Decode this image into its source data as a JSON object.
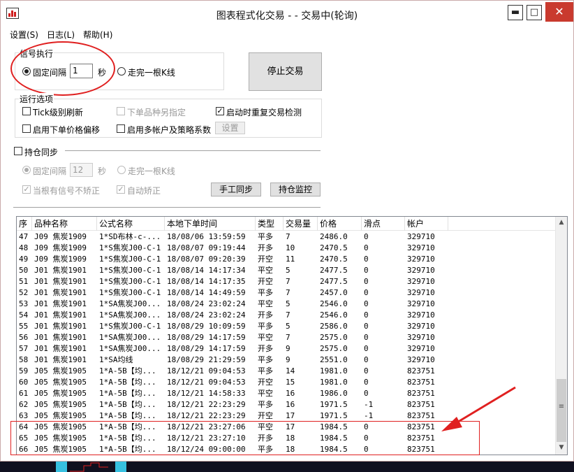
{
  "window": {
    "title": "图表程式化交易 - - 交易中(轮询)",
    "minimize": "▬",
    "maximize": "□",
    "close": "✕"
  },
  "menu": [
    "设置(S)",
    "日志(L)",
    "帮助(H)"
  ],
  "signal": {
    "group_label": "信号执行",
    "fixed_interval_label": "固定间隔",
    "interval_value": "1",
    "seconds_unit": "秒",
    "bar_complete_label": "走完一根K线",
    "stop_button": "停止交易"
  },
  "run_options": {
    "group_label": "运行选项",
    "tick_refresh": "Tick级别刷新",
    "order_variety": "下单品种另指定",
    "startup_check": "启动时重复交易检测",
    "price_offset": "启用下单价格偏移",
    "multi_account": "启用多帐户及策略系数",
    "settings_button": "设置"
  },
  "position_sync": {
    "label": "持仓同步",
    "fixed_interval_label": "固定间隔",
    "interval_value": "12",
    "seconds_unit": "秒",
    "bar_complete_label": "走完一根K线",
    "no_correct_label": "当根有信号不矫正",
    "auto_correct_label": "自动矫正",
    "manual_sync_button": "手工同步",
    "monitor_button": "持仓监控"
  },
  "table": {
    "columns": [
      "序",
      "品种名称",
      "公式名称",
      "本地下单时间",
      "类型",
      "交易量",
      "价格",
      "滑点",
      "帐户"
    ],
    "rows": [
      [
        "47",
        "J09 焦炭1909",
        "1*SD布林-c-...",
        "18/08/06 13:59:59",
        "平多",
        "7",
        "2486.0",
        "0",
        "329710"
      ],
      [
        "48",
        "J09 焦炭1909",
        "1*S焦炭J00-C-1",
        "18/08/07 09:19:44",
        "开多",
        "10",
        "2470.5",
        "0",
        "329710"
      ],
      [
        "49",
        "J09 焦炭1909",
        "1*S焦炭J00-C-1",
        "18/08/07 09:20:39",
        "开空",
        "11",
        "2470.5",
        "0",
        "329710"
      ],
      [
        "50",
        "J01 焦炭1901",
        "1*S焦炭J00-C-1",
        "18/08/14 14:17:34",
        "平空",
        "5",
        "2477.5",
        "0",
        "329710"
      ],
      [
        "51",
        "J01 焦炭1901",
        "1*S焦炭J00-C-1",
        "18/08/14 14:17:35",
        "开空",
        "7",
        "2477.5",
        "0",
        "329710"
      ],
      [
        "52",
        "J01 焦炭1901",
        "1*S焦炭J00-C-1",
        "18/08/14 14:49:59",
        "平多",
        "7",
        "2457.0",
        "0",
        "329710"
      ],
      [
        "53",
        "J01 焦炭1901",
        "1*SA焦炭J00...",
        "18/08/24 23:02:24",
        "平空",
        "5",
        "2546.0",
        "0",
        "329710"
      ],
      [
        "54",
        "J01 焦炭1901",
        "1*SA焦炭J00...",
        "18/08/24 23:02:24",
        "开多",
        "7",
        "2546.0",
        "0",
        "329710"
      ],
      [
        "55",
        "J01 焦炭1901",
        "1*S焦炭J00-C-1",
        "18/08/29 10:09:59",
        "平多",
        "5",
        "2586.0",
        "0",
        "329710"
      ],
      [
        "56",
        "J01 焦炭1901",
        "1*SA焦炭J00...",
        "18/08/29 14:17:59",
        "平空",
        "7",
        "2575.0",
        "0",
        "329710"
      ],
      [
        "57",
        "J01 焦炭1901",
        "1*SA焦炭J00...",
        "18/08/29 14:17:59",
        "开多",
        "9",
        "2575.0",
        "0",
        "329710"
      ],
      [
        "58",
        "J01 焦炭1901",
        "1*SA均线",
        "18/08/29 21:29:59",
        "平多",
        "9",
        "2551.0",
        "0",
        "329710"
      ],
      [
        "59",
        "J05 焦炭1905",
        "1*A-5B【均...",
        "18/12/21 09:04:53",
        "平多",
        "14",
        "1981.0",
        "0",
        "823751"
      ],
      [
        "60",
        "J05 焦炭1905",
        "1*A-5B【均...",
        "18/12/21 09:04:53",
        "开空",
        "15",
        "1981.0",
        "0",
        "823751"
      ],
      [
        "61",
        "J05 焦炭1905",
        "1*A-5B【均...",
        "18/12/21 14:58:33",
        "平空",
        "16",
        "1986.0",
        "0",
        "823751"
      ],
      [
        "62",
        "J05 焦炭1905",
        "1*A-5B【均...",
        "18/12/21 22:23:29",
        "平多",
        "16",
        "1971.5",
        "-1",
        "823751"
      ],
      [
        "63",
        "J05 焦炭1905",
        "1*A-5B【均...",
        "18/12/21 22:23:29",
        "开空",
        "17",
        "1971.5",
        "-1",
        "823751"
      ],
      [
        "64",
        "J05 焦炭1905",
        "1*A-5B【均...",
        "18/12/21 23:27:06",
        "平空",
        "17",
        "1984.5",
        "0",
        "823751"
      ],
      [
        "65",
        "J05 焦炭1905",
        "1*A-5B【均...",
        "18/12/21 23:27:10",
        "开多",
        "18",
        "1984.5",
        "0",
        "823751"
      ],
      [
        "66",
        "J05 焦炭1905",
        "1*A-5B【均...",
        "18/12/24 09:00:00",
        "平多",
        "18",
        "1984.5",
        "0",
        "823751"
      ]
    ]
  },
  "colors": {
    "annotation_red": "#e02020",
    "close_button": "#c93a2e",
    "taskbar_accent": "#37c0e0"
  },
  "icons": [
    "app-chart-icon",
    "radio-icon",
    "checkbox-icon",
    "scroll-up-icon",
    "scroll-down-icon",
    "annotation-arrow-icon"
  ]
}
